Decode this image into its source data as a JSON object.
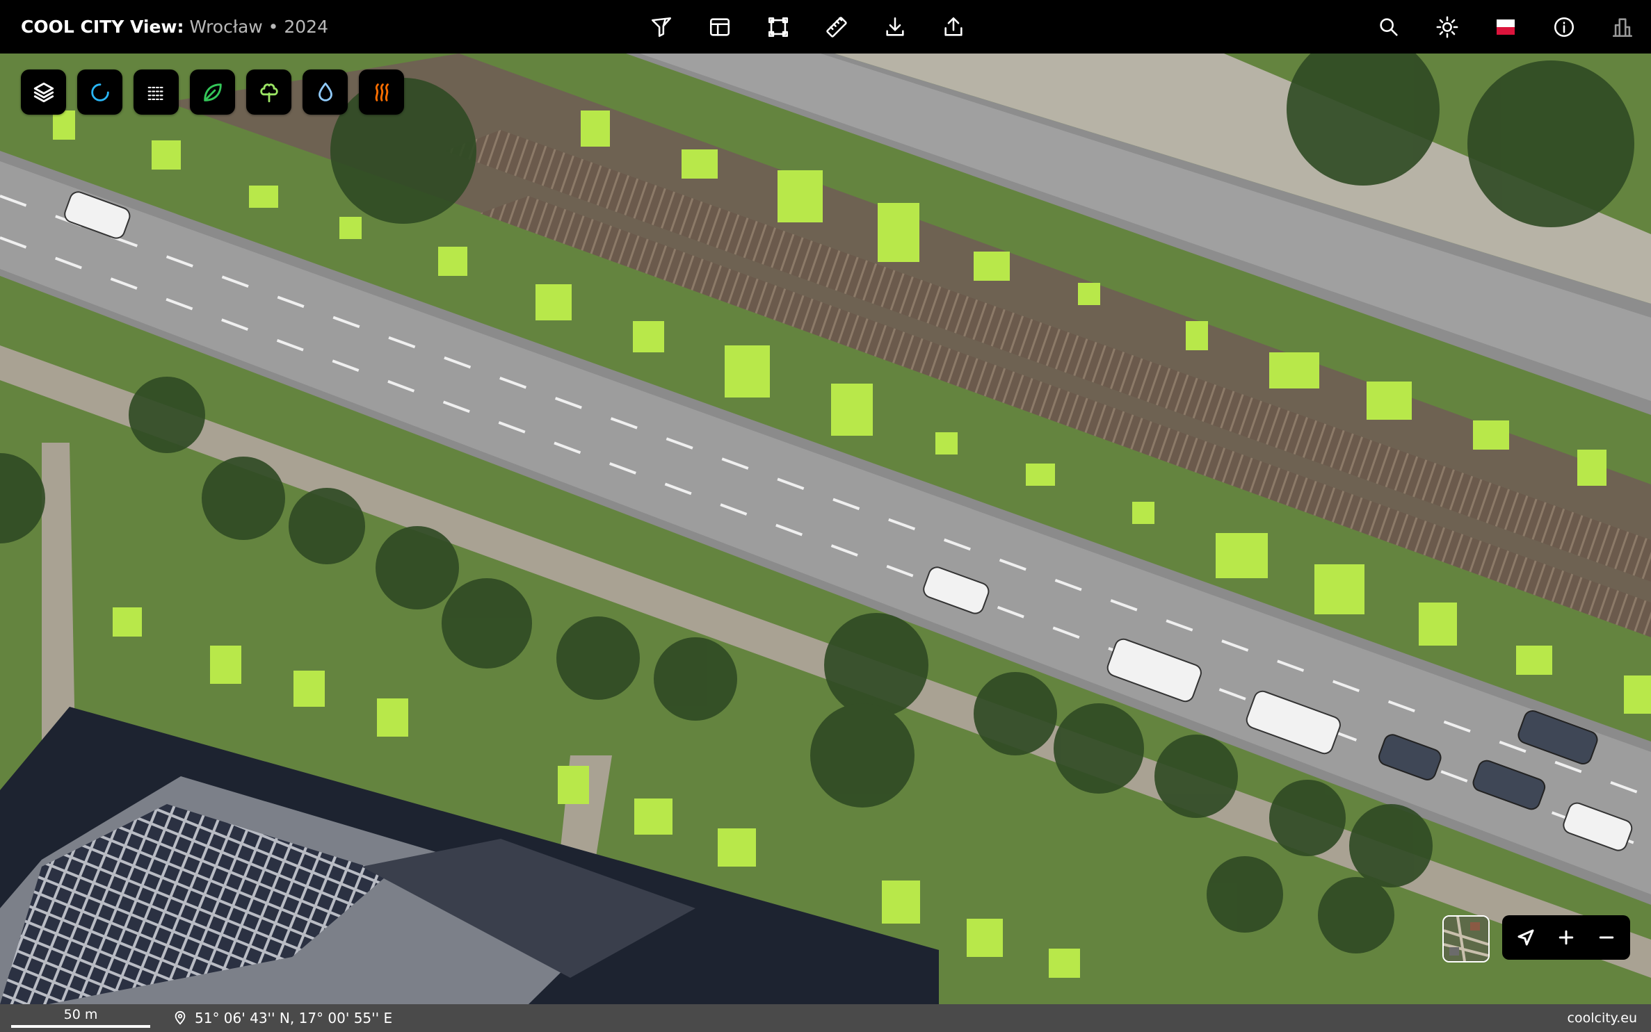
{
  "header": {
    "brand": "COOL CITY View:",
    "location": " Wrocław • 2024"
  },
  "toolbar_center": [
    {
      "name": "filter-icon"
    },
    {
      "name": "table-layout-icon"
    },
    {
      "name": "select-area-icon"
    },
    {
      "name": "ruler-icon"
    },
    {
      "name": "download-icon"
    },
    {
      "name": "share-icon"
    }
  ],
  "toolbar_right": [
    {
      "name": "search-icon"
    },
    {
      "name": "brightness-icon"
    },
    {
      "name": "poland-flag-icon"
    },
    {
      "name": "info-icon"
    },
    {
      "name": "buildings-icon"
    }
  ],
  "layer_buttons": [
    {
      "name": "layers-icon",
      "color": "#ffffff"
    },
    {
      "name": "loading-ring-icon",
      "color": "#29b6f6"
    },
    {
      "name": "lines-icon",
      "color": "#ffffff"
    },
    {
      "name": "leaf-icon",
      "color": "#34c759"
    },
    {
      "name": "tree-icon",
      "color": "#9be564"
    },
    {
      "name": "water-drop-icon",
      "color": "#90caf9"
    },
    {
      "name": "heat-icon",
      "color": "#ff6f00"
    }
  ],
  "tree_highlight_color": "#b8e84a",
  "statusbar": {
    "scale": "50 m",
    "coordinates": "51° 06' 43'' N, 17° 00' 55'' E",
    "site": "coolcity.eu"
  }
}
